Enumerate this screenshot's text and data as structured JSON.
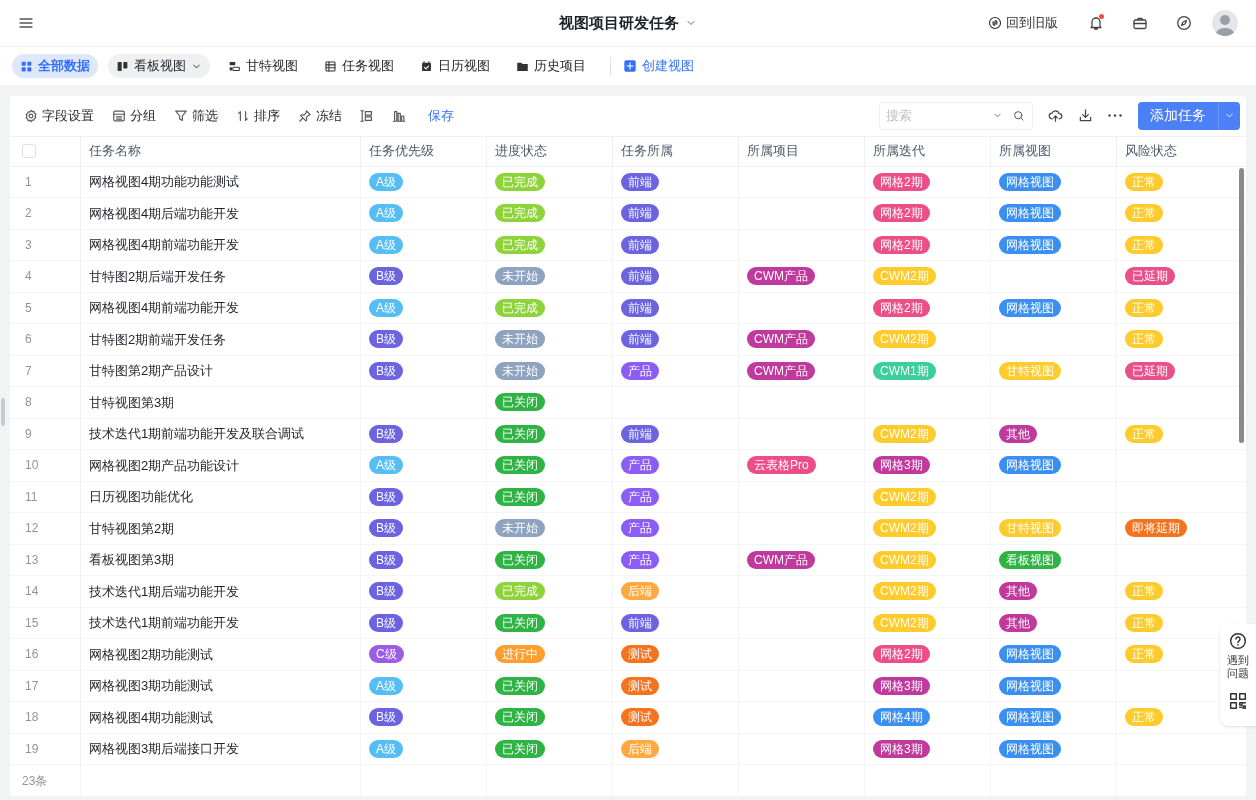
{
  "header": {
    "title": "视图项目研发任务",
    "old_version": "回到旧版",
    "has_notification": true
  },
  "views": [
    {
      "label": "全部数据",
      "selected": true,
      "kind": "plain"
    },
    {
      "label": "看板视图",
      "selected": false,
      "kind": "dropdown"
    },
    {
      "label": "甘特视图",
      "selected": false,
      "kind": "plain"
    },
    {
      "label": "任务视图",
      "selected": false,
      "kind": "plain"
    },
    {
      "label": "日历视图",
      "selected": false,
      "kind": "plain"
    },
    {
      "label": "历史项目",
      "selected": false,
      "kind": "plain"
    }
  ],
  "create_view": "创建视图",
  "toolbar": {
    "items": [
      "字段设置",
      "分组",
      "筛选",
      "排序",
      "冻结"
    ],
    "save": "保存",
    "search": {
      "placeholder": "搜索"
    },
    "add_button": "添加任务"
  },
  "table": {
    "header_checkbox": {
      "checked": false
    },
    "columns": [
      "",
      "任务名称",
      "任务优先级",
      "进度状态",
      "任务所属",
      "所属项目",
      "所属迭代",
      "所属视图",
      "风险状态"
    ],
    "rows": [
      {
        "cells": [
          "1",
          "网格视图4期功能功能测试",
          {
            "text": "A级",
            "color": "#56bdf5"
          },
          {
            "text": "已完成",
            "color": "#8fd33b"
          },
          {
            "text": "前端",
            "color": "#6b63e0"
          },
          null,
          {
            "text": "网格2期",
            "color": "#ec4f87"
          },
          {
            "text": "网格视图",
            "color": "#3b8ff0"
          },
          {
            "text": "正常",
            "color": "#fdcb2b"
          }
        ]
      },
      {
        "cells": [
          "2",
          "网格视图4期后端功能开发",
          {
            "text": "A级",
            "color": "#56bdf5"
          },
          {
            "text": "已完成",
            "color": "#8fd33b"
          },
          {
            "text": "前端",
            "color": "#6b63e0"
          },
          null,
          {
            "text": "网格2期",
            "color": "#ec4f87"
          },
          {
            "text": "网格视图",
            "color": "#3b8ff0"
          },
          {
            "text": "正常",
            "color": "#fdcb2b"
          }
        ]
      },
      {
        "cells": [
          "3",
          "网格视图4期前端功能开发",
          {
            "text": "A级",
            "color": "#56bdf5"
          },
          {
            "text": "已完成",
            "color": "#8fd33b"
          },
          {
            "text": "前端",
            "color": "#6b63e0"
          },
          null,
          {
            "text": "网格2期",
            "color": "#ec4f87"
          },
          {
            "text": "网格视图",
            "color": "#3b8ff0"
          },
          {
            "text": "正常",
            "color": "#fdcb2b"
          }
        ]
      },
      {
        "cells": [
          "4",
          "甘特图2期后端开发任务",
          {
            "text": "B级",
            "color": "#6b63e0"
          },
          {
            "text": "未开始",
            "color": "#8ea3bf"
          },
          {
            "text": "前端",
            "color": "#6b63e0"
          },
          {
            "text": "CWM产品",
            "color": "#c0399c"
          },
          {
            "text": "CWM2期",
            "color": "#fdcb2b"
          },
          null,
          {
            "text": "已延期",
            "color": "#e8508a"
          }
        ]
      },
      {
        "cells": [
          "5",
          "网格视图4期前端功能开发",
          {
            "text": "A级",
            "color": "#56bdf5"
          },
          {
            "text": "已完成",
            "color": "#8fd33b"
          },
          {
            "text": "前端",
            "color": "#6b63e0"
          },
          null,
          {
            "text": "网格2期",
            "color": "#ec4f87"
          },
          {
            "text": "网格视图",
            "color": "#3b8ff0"
          },
          {
            "text": "正常",
            "color": "#fdcb2b"
          }
        ]
      },
      {
        "cells": [
          "6",
          "甘特图2期前端开发任务",
          {
            "text": "B级",
            "color": "#6b63e0"
          },
          {
            "text": "未开始",
            "color": "#8ea3bf"
          },
          {
            "text": "前端",
            "color": "#6b63e0"
          },
          {
            "text": "CWM产品",
            "color": "#c0399c"
          },
          {
            "text": "CWM2期",
            "color": "#fdcb2b"
          },
          null,
          {
            "text": "正常",
            "color": "#fdcb2b"
          }
        ]
      },
      {
        "cells": [
          "7",
          "甘特图第2期产品设计",
          {
            "text": "B级",
            "color": "#6b63e0"
          },
          {
            "text": "未开始",
            "color": "#8ea3bf"
          },
          {
            "text": "产品",
            "color": "#8b5cf6"
          },
          {
            "text": "CWM产品",
            "color": "#c0399c"
          },
          {
            "text": "CWM1期",
            "color": "#3ccf9a"
          },
          {
            "text": "甘特视图",
            "color": "#fdcb2b"
          },
          {
            "text": "已延期",
            "color": "#e8508a"
          }
        ]
      },
      {
        "cells": [
          "8",
          "甘特视图第3期",
          null,
          {
            "text": "已关闭",
            "color": "#2fb344"
          },
          null,
          null,
          null,
          null,
          null
        ]
      },
      {
        "cells": [
          "9",
          "技术迭代1期前端功能开发及联合调试",
          {
            "text": "B级",
            "color": "#6b63e0"
          },
          {
            "text": "已关闭",
            "color": "#2fb344"
          },
          {
            "text": "前端",
            "color": "#6b63e0"
          },
          null,
          {
            "text": "CWM2期",
            "color": "#fdcb2b"
          },
          {
            "text": "其他",
            "color": "#c0399c"
          },
          {
            "text": "正常",
            "color": "#fdcb2b"
          }
        ]
      },
      {
        "cells": [
          "10",
          "网格视图2期产品功能设计",
          {
            "text": "A级",
            "color": "#56bdf5"
          },
          {
            "text": "已关闭",
            "color": "#2fb344"
          },
          {
            "text": "产品",
            "color": "#8b5cf6"
          },
          {
            "text": "云表格Pro",
            "color": "#ec4f87"
          },
          {
            "text": "网格3期",
            "color": "#c0399c"
          },
          {
            "text": "网格视图",
            "color": "#3b8ff0"
          },
          null
        ]
      },
      {
        "cells": [
          "11",
          "日历视图功能优化",
          {
            "text": "B级",
            "color": "#6b63e0"
          },
          {
            "text": "已关闭",
            "color": "#2fb344"
          },
          {
            "text": "产品",
            "color": "#8b5cf6"
          },
          null,
          {
            "text": "CWM2期",
            "color": "#fdcb2b"
          },
          null,
          null
        ]
      },
      {
        "cells": [
          "12",
          "甘特视图第2期",
          {
            "text": "B级",
            "color": "#6b63e0"
          },
          {
            "text": "未开始",
            "color": "#8ea3bf"
          },
          {
            "text": "产品",
            "color": "#8b5cf6"
          },
          null,
          {
            "text": "CWM2期",
            "color": "#fdcb2b"
          },
          {
            "text": "甘特视图",
            "color": "#fdcb2b"
          },
          {
            "text": "即将延期",
            "color": "#f5731e"
          }
        ]
      },
      {
        "cells": [
          "13",
          "看板视图第3期",
          {
            "text": "B级",
            "color": "#6b63e0"
          },
          {
            "text": "已关闭",
            "color": "#2fb344"
          },
          {
            "text": "产品",
            "color": "#8b5cf6"
          },
          {
            "text": "CWM产品",
            "color": "#c0399c"
          },
          {
            "text": "CWM2期",
            "color": "#fdcb2b"
          },
          {
            "text": "看板视图",
            "color": "#2fb344"
          },
          null
        ]
      },
      {
        "cells": [
          "14",
          "技术迭代1期后端功能开发",
          {
            "text": "B级",
            "color": "#6b63e0"
          },
          {
            "text": "已完成",
            "color": "#8fd33b"
          },
          {
            "text": "后端",
            "color": "#ffa940"
          },
          null,
          {
            "text": "CWM2期",
            "color": "#fdcb2b"
          },
          {
            "text": "其他",
            "color": "#c0399c"
          },
          {
            "text": "正常",
            "color": "#fdcb2b"
          }
        ]
      },
      {
        "cells": [
          "15",
          "技术迭代1期前端功能开发",
          {
            "text": "B级",
            "color": "#6b63e0"
          },
          {
            "text": "已关闭",
            "color": "#2fb344"
          },
          {
            "text": "前端",
            "color": "#6b63e0"
          },
          null,
          {
            "text": "CWM2期",
            "color": "#fdcb2b"
          },
          {
            "text": "其他",
            "color": "#c0399c"
          },
          {
            "text": "正常",
            "color": "#fdcb2b"
          }
        ]
      },
      {
        "cells": [
          "16",
          "网格视图2期功能测试",
          {
            "text": "C级",
            "color": "#9b5de5"
          },
          {
            "text": "进行中",
            "color": "#ff9d2e"
          },
          {
            "text": "测试",
            "color": "#f5731e"
          },
          null,
          {
            "text": "网格2期",
            "color": "#ec4f87"
          },
          {
            "text": "网格视图",
            "color": "#3b8ff0"
          },
          {
            "text": "正常",
            "color": "#fdcb2b"
          }
        ]
      },
      {
        "cells": [
          "17",
          "网格视图3期功能测试",
          {
            "text": "A级",
            "color": "#56bdf5"
          },
          {
            "text": "已关闭",
            "color": "#2fb344"
          },
          {
            "text": "测试",
            "color": "#f5731e"
          },
          null,
          {
            "text": "网格3期",
            "color": "#c0399c"
          },
          {
            "text": "网格视图",
            "color": "#3b8ff0"
          },
          null
        ]
      },
      {
        "cells": [
          "18",
          "网格视图4期功能测试",
          {
            "text": "B级",
            "color": "#6b63e0"
          },
          {
            "text": "已关闭",
            "color": "#2fb344"
          },
          {
            "text": "测试",
            "color": "#f5731e"
          },
          null,
          {
            "text": "网格4期",
            "color": "#3b8ff0"
          },
          {
            "text": "网格视图",
            "color": "#3b8ff0"
          },
          {
            "text": "正常",
            "color": "#fdcb2b"
          }
        ]
      },
      {
        "cells": [
          "19",
          "网格视图3期后端接口开发",
          {
            "text": "A级",
            "color": "#56bdf5"
          },
          {
            "text": "已关闭",
            "color": "#2fb344"
          },
          {
            "text": "后端",
            "color": "#ffa940"
          },
          null,
          {
            "text": "网格3期",
            "color": "#c0399c"
          },
          {
            "text": "网格视图",
            "color": "#3b8ff0"
          },
          null
        ]
      }
    ],
    "footer": "23条"
  },
  "help": {
    "label": "遇到问题"
  }
}
